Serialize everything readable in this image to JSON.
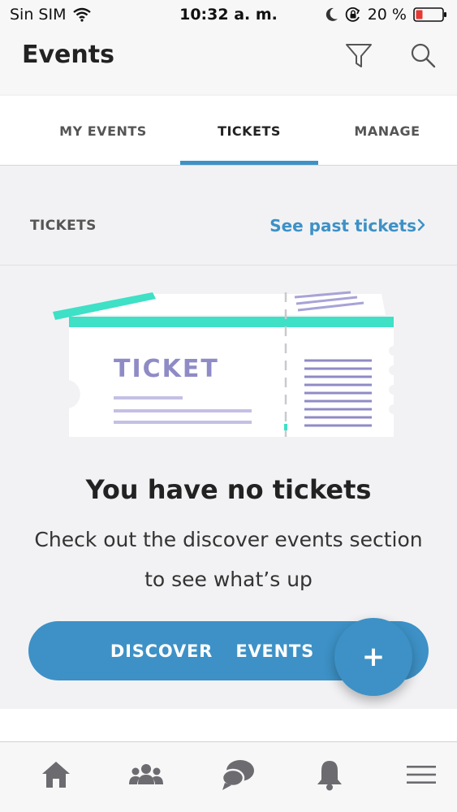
{
  "status": {
    "carrier": "Sin SIM",
    "time": "10:32 a. m.",
    "battery": "20 %",
    "icons": [
      "wifi-icon",
      "moon-icon",
      "orientation-lock-icon",
      "battery-icon"
    ]
  },
  "header": {
    "title": "Events",
    "filter_icon": "filter-icon",
    "search_icon": "search-icon"
  },
  "tabs": [
    {
      "label": "MY EVENTS"
    },
    {
      "label": "TICKETS",
      "active": true
    },
    {
      "label": "MANAGE"
    }
  ],
  "section": {
    "label": "TICKETS",
    "link": "See past tickets"
  },
  "illustration": {
    "ticket_text": "TICKET"
  },
  "empty": {
    "title": "You have no tickets",
    "line1": "Check out the discover events section",
    "line2": "to see what’s up"
  },
  "discover_button": "DISCOVER  EVENTS",
  "fab_label": "+",
  "tabbar": {
    "icons": [
      "home-icon",
      "people-icon",
      "chat-icon",
      "bell-icon",
      "menu-icon"
    ]
  },
  "colors": {
    "accent": "#3d91c6",
    "teal": "#3ee0c6",
    "lavender": "#a8a3d6",
    "background": "#f2f2f4"
  }
}
